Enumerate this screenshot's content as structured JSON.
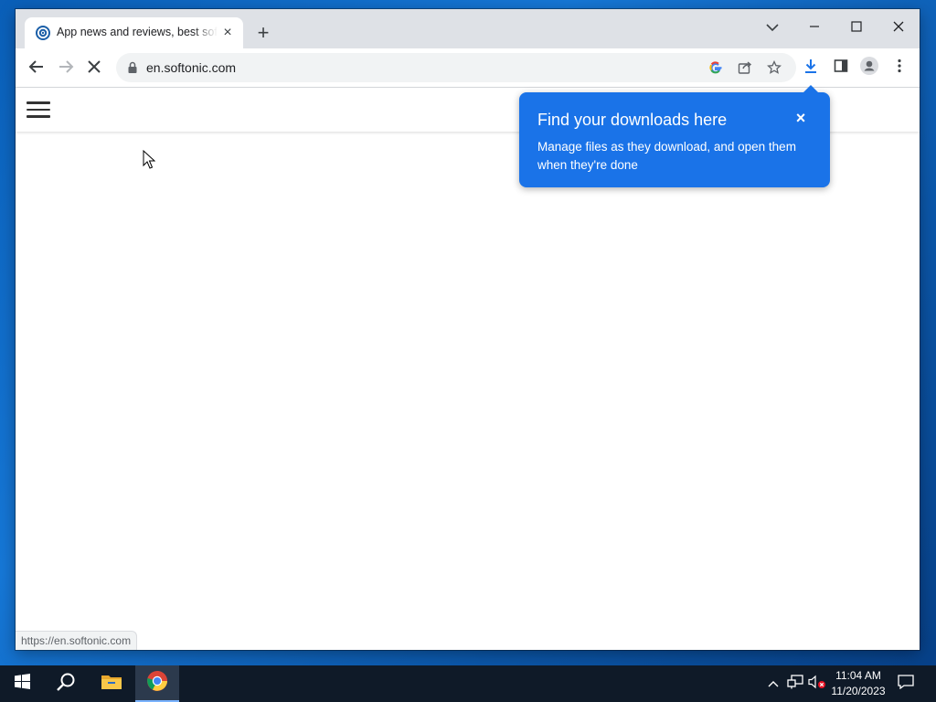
{
  "tab": {
    "title": "App news and reviews, best software downloads and discovery",
    "close_label": "×",
    "favicon": "softonic-logo-icon"
  },
  "newtab": {
    "label": "+"
  },
  "window_controls": {
    "tab_search": "chevron-down-icon",
    "minimize": "minimize-icon",
    "maximize": "maximize-icon",
    "close": "close-icon"
  },
  "toolbar": {
    "back": "back-arrow-icon",
    "forward": "forward-arrow-icon",
    "stop": "stop-loading-icon",
    "url": "en.softonic.com",
    "lock": "lock-icon",
    "google": "google-lens-icon",
    "share": "share-icon",
    "bookmark": "star-icon",
    "download": "download-icon",
    "side_panel": "side-panel-icon",
    "profile": "profile-avatar-icon",
    "menu": "kebab-menu-icon"
  },
  "download_bubble": {
    "title": "Find your downloads here",
    "body": "Manage files as they download, and open them when they're done",
    "close_label": "×"
  },
  "status_url": "https://en.softonic.com",
  "taskbar": {
    "items": [
      "start-windows-icon",
      "search-icon",
      "file-explorer-icon",
      "chrome-icon"
    ],
    "tray": [
      "chevron-up-icon",
      "network-icon",
      "volume-muted-icon",
      "notification-icon"
    ],
    "time": "11:04 AM",
    "date": "11/20/2023"
  },
  "colors": {
    "accent": "#1a73e8",
    "titlebar": "#dee1e6",
    "taskbar": "#0f1a28"
  }
}
